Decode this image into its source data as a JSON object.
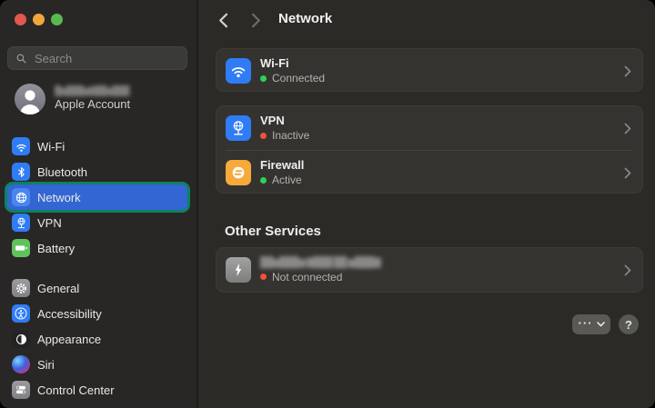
{
  "colors": {
    "accent_blue": "#2f7cf5",
    "selected_blue": "#3366d2",
    "highlight_green_border": "#0e8162",
    "battery_green": "#5fc35c",
    "firewall_orange": "#f7a93b",
    "status_green": "#30d158",
    "status_red": "#f4503a",
    "traffic_red": "#e2574e",
    "traffic_yellow": "#f0a73b",
    "traffic_green": "#58b951",
    "thunderbolt_gray": "#9a9a9a"
  },
  "sidebar": {
    "search": {
      "placeholder": "Search"
    },
    "account": {
      "name_redacted": "█▆███▆▇██▆███",
      "label": "Apple Account"
    },
    "groups": [
      {
        "items": [
          {
            "label": "Wi-Fi"
          },
          {
            "label": "Bluetooth"
          },
          {
            "label": "Network"
          },
          {
            "label": "VPN"
          },
          {
            "label": "Battery"
          }
        ]
      },
      {
        "items": [
          {
            "label": "General"
          },
          {
            "label": "Accessibility"
          },
          {
            "label": "Appearance"
          },
          {
            "label": "Siri"
          },
          {
            "label": "Control Center"
          }
        ]
      }
    ]
  },
  "main": {
    "title": "Network",
    "services": [
      {
        "name": "Wi-Fi",
        "status": "Connected"
      },
      {
        "name": "VPN",
        "status": "Inactive"
      },
      {
        "name": "Firewall",
        "status": "Active"
      }
    ],
    "other_services": {
      "label": "Other Services",
      "items": [
        {
          "name_redacted": "██▆███▆ ▇███ ██ ▆███▇",
          "status": "Not connected"
        }
      ]
    },
    "more_button_label": "···",
    "help_button_label": "?"
  }
}
